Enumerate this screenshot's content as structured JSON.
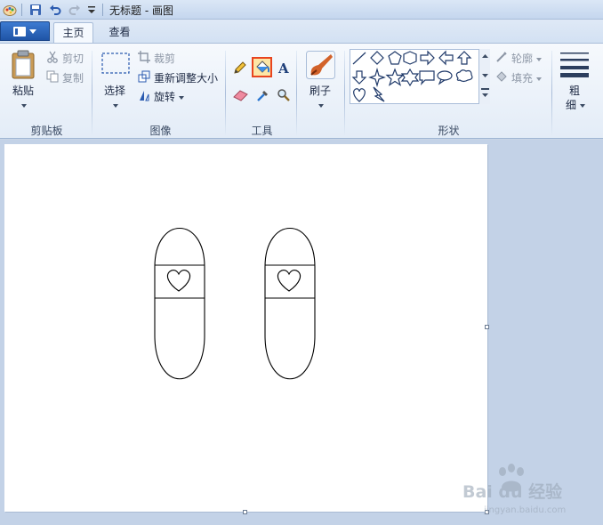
{
  "window": {
    "title": "无标题 - 画图"
  },
  "tabs": [
    {
      "label": "主页",
      "active": true
    },
    {
      "label": "查看",
      "active": false
    }
  ],
  "ribbon": {
    "clipboard": {
      "group_label": "剪贴板",
      "paste": "粘贴",
      "cut": "剪切",
      "copy": "复制"
    },
    "image": {
      "group_label": "图像",
      "select": "选择",
      "crop": "裁剪",
      "resize": "重新调整大小",
      "rotate": "旋转"
    },
    "tools": {
      "group_label": "工具",
      "selected_tool": "fill-bucket"
    },
    "brushes": {
      "label": "刷子"
    },
    "shapes": {
      "group_label": "形状",
      "outline": "轮廓",
      "fill": "填充"
    },
    "size": {
      "label_line1": "粗",
      "label_line2": "细"
    }
  },
  "watermark": {
    "brand": "Bai du 经验",
    "url": "jingyan.baidu.com"
  },
  "colors": {
    "accent": "#1f54a6",
    "selected_tool_border": "#e8451f",
    "canvas": "#ffffff",
    "workspace": "#c3d2e7"
  }
}
